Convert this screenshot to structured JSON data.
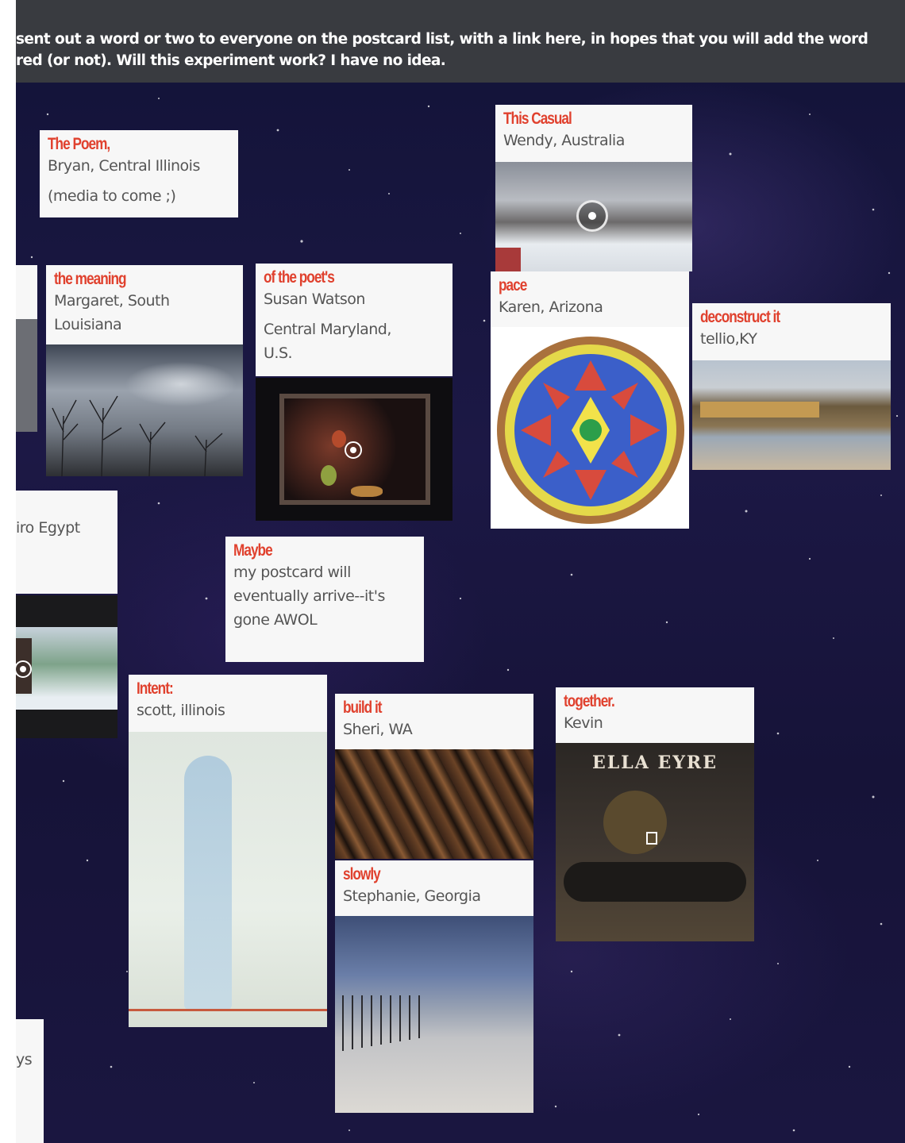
{
  "header": {
    "line1": "sent out a word or two to everyone on the postcard list, with a link here, in hopes that you will add the word",
    "line2": "red (or not). Will this experiment work? I have no idea."
  },
  "cards": {
    "poem": {
      "title": "The Poem,",
      "sub1": "Bryan, Central Illinois",
      "sub2": "(media to come ;)"
    },
    "casual": {
      "title": "This Casual",
      "sub1": "Wendy, Australia"
    },
    "meaning": {
      "title": "the meaning",
      "sub1": "Margaret, South",
      "sub2": "Louisiana"
    },
    "poets": {
      "title": "of the poet's",
      "sub1": "Susan Watson",
      "sub2": "Central Maryland,",
      "sub3": "U.S."
    },
    "pace": {
      "title": "pace",
      "sub1": "Karen, Arizona"
    },
    "deconstruct": {
      "title": "deconstruct it",
      "sub1": "tellio,KY"
    },
    "cairo": {
      "sub1": "iro Egypt"
    },
    "maybe": {
      "title": "Maybe",
      "sub1": "my postcard will",
      "sub2": "eventually arrive--it's",
      "sub3": "gone AWOL"
    },
    "intent": {
      "title": "Intent:",
      "sub1": "scott, illinois"
    },
    "build": {
      "title": "build it",
      "sub1": "Sheri, WA"
    },
    "slowly": {
      "title": "slowly",
      "sub1": "Stephanie, Georgia"
    },
    "together": {
      "title": "together.",
      "sub1": "Kevin",
      "album_text": "ELLA EYRE"
    },
    "bottomleft": {
      "sub1": "ys"
    }
  },
  "colors": {
    "header_bg": "#393b40",
    "title_red": "#e0412e",
    "card_bg": "#f7f7f7",
    "space": "#1a1640"
  }
}
